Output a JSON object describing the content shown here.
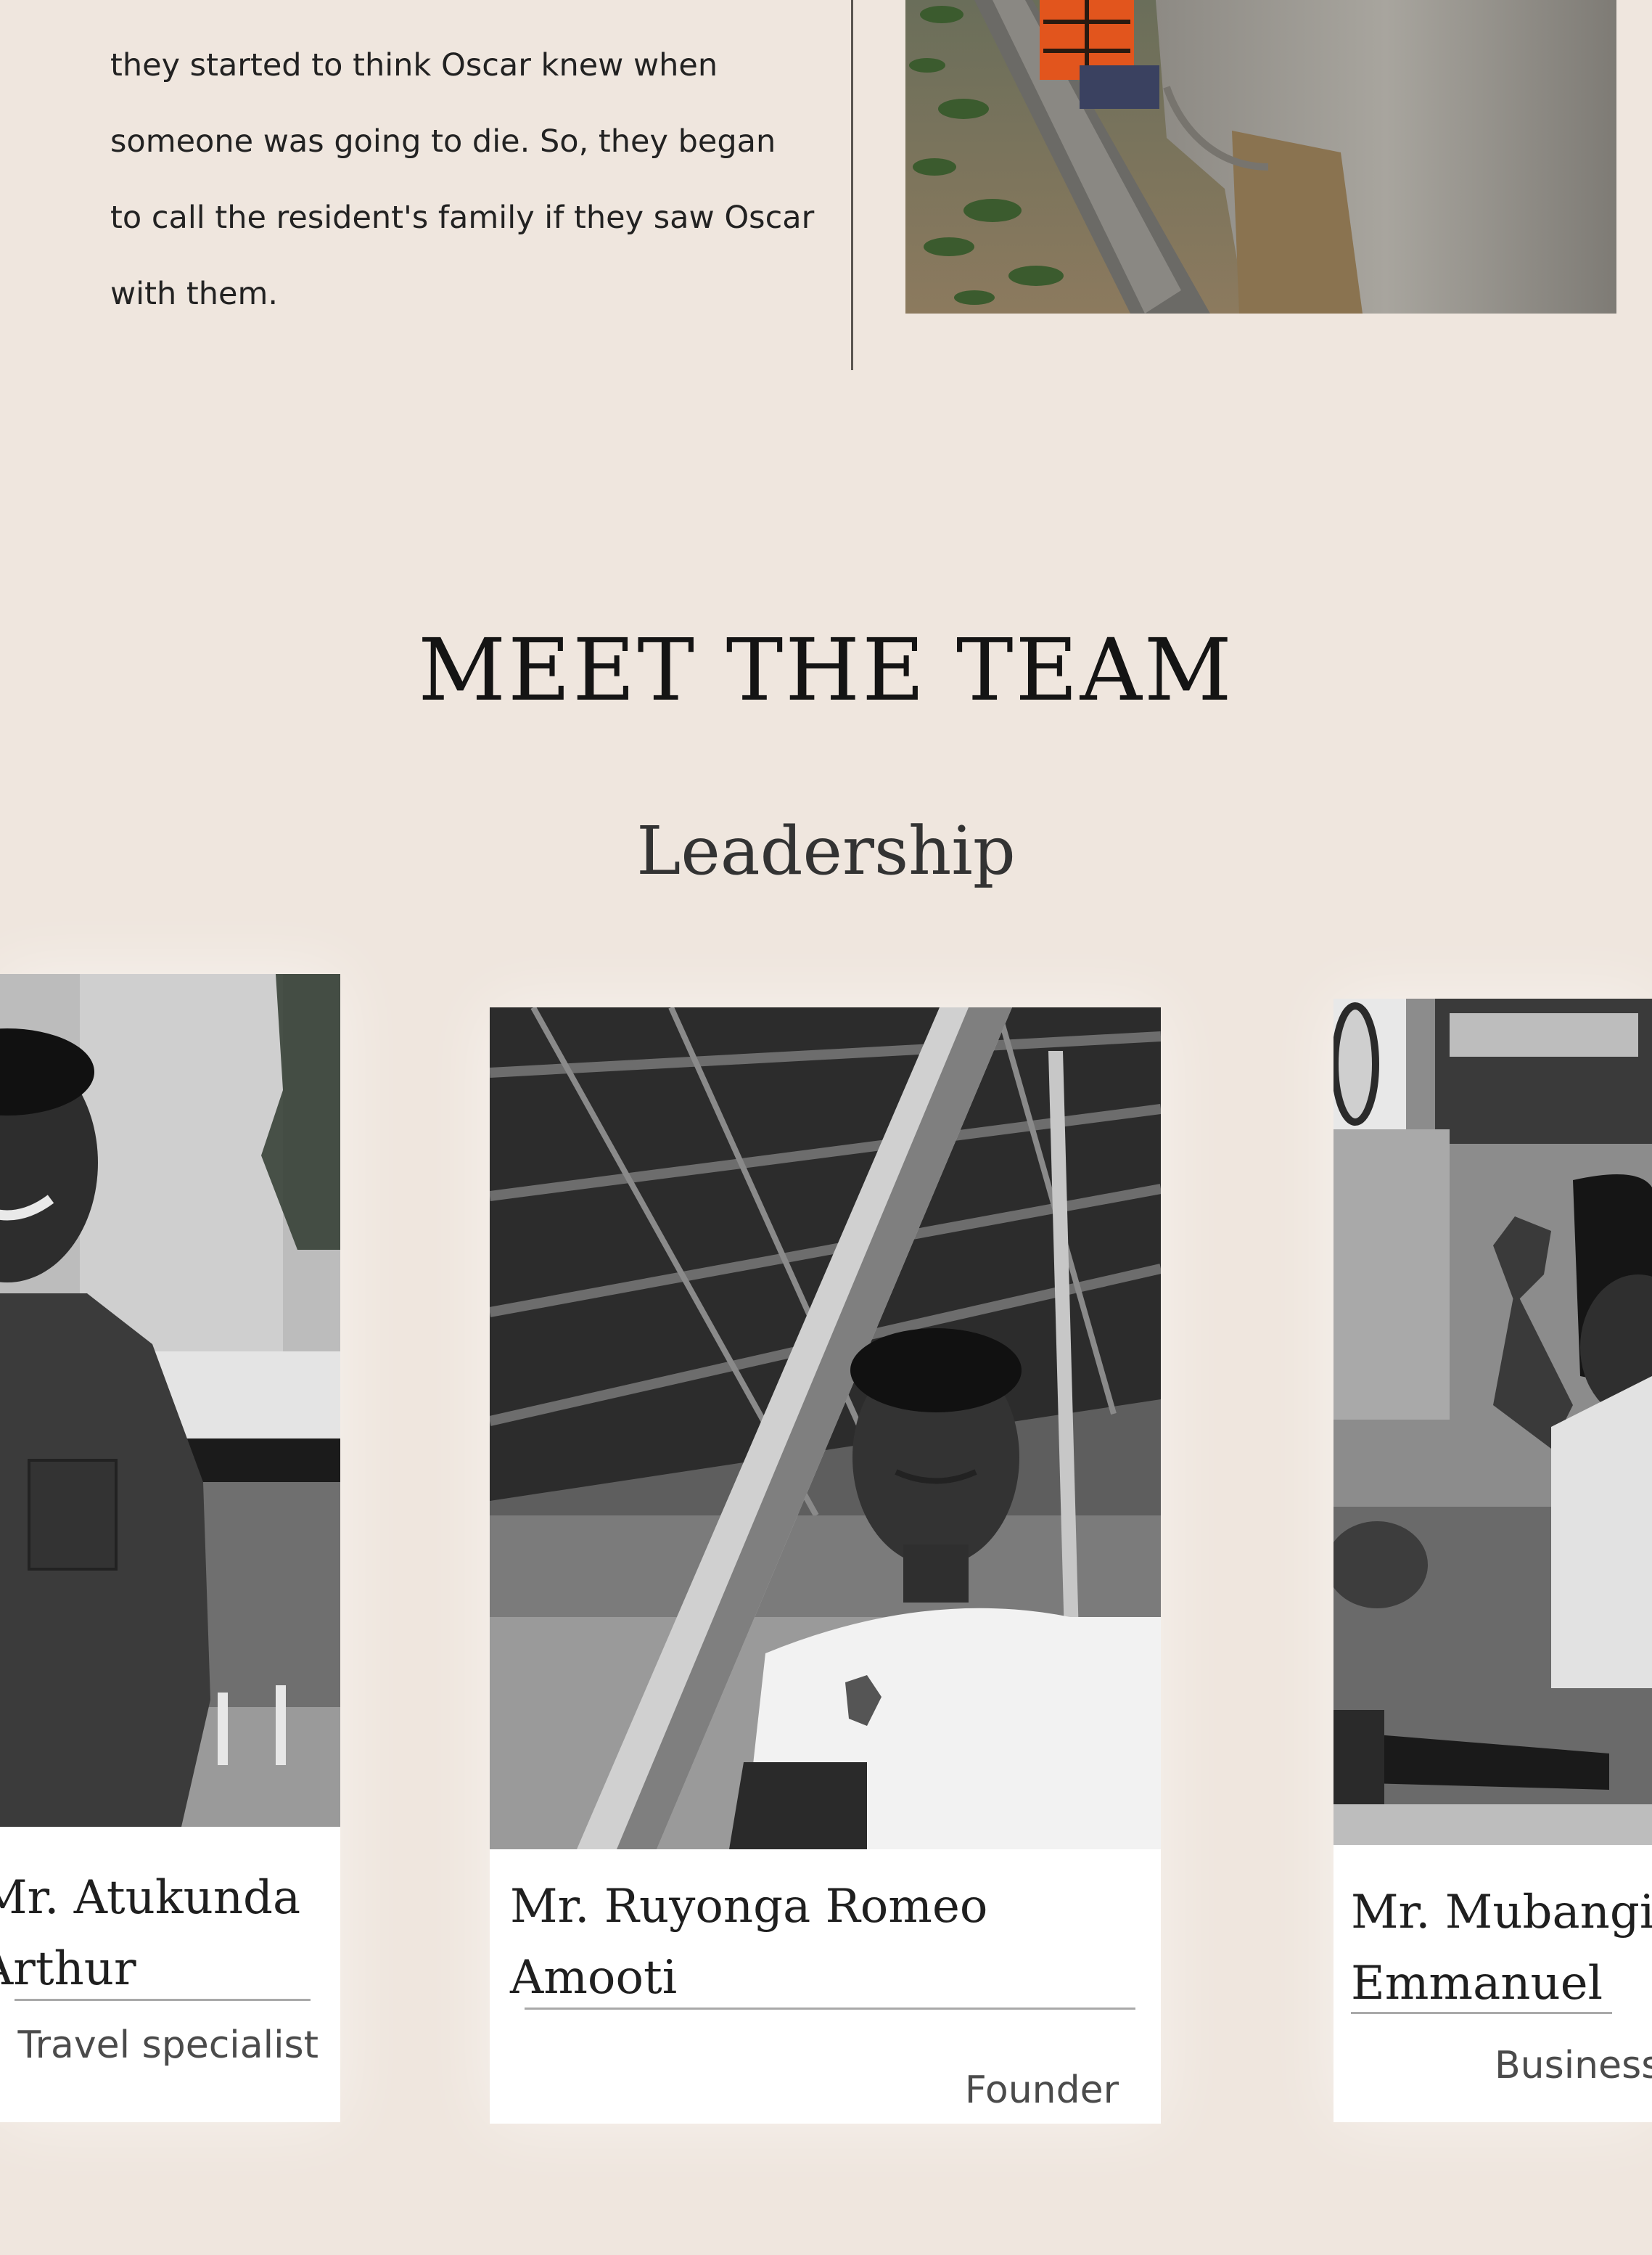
{
  "story": {
    "lines": [
      "they started to think Oscar knew when",
      "someone was going to die. So, they began",
      "to call the resident's family if they saw Oscar",
      "with them."
    ]
  },
  "team": {
    "title": "MEET THE TEAM",
    "subtitle": "Leadership",
    "members": [
      {
        "name_line1": "Mr. Atukunda",
        "name_line2": "Arthur",
        "role": "Travel specialist"
      },
      {
        "name_line1": "Mr. Ruyonga Romeo",
        "name_line2": "Amooti",
        "role": "Founder"
      },
      {
        "name_line1": "Mr. Mubangizi",
        "name_line2": "Emmanuel",
        "role": "Business"
      }
    ]
  }
}
